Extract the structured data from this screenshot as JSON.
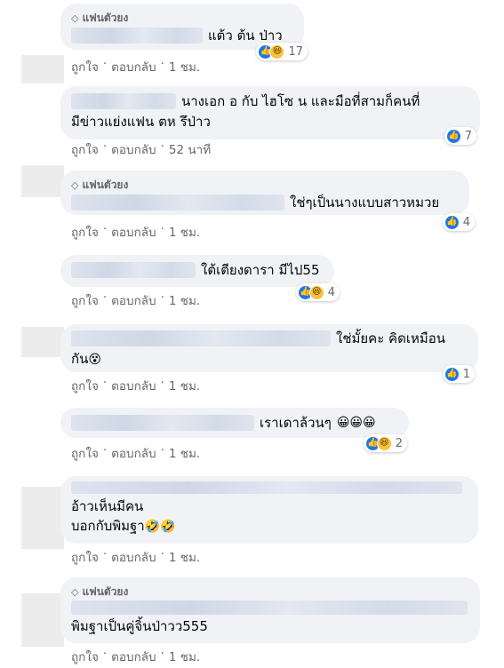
{
  "actions": {
    "like": "ถูกใจ",
    "reply": "ตอบกลับ",
    "dot": "·"
  },
  "badge": "แฟนตัวยง",
  "comments": [
    {
      "text": "แต้ว ต้น ป่าว",
      "time": "1 ชม.",
      "reactions": "17"
    },
    {
      "text1": "นางเอก อ กับ ไฮโซ น และมือที่สามก็คนที่",
      "text2": "มีข่าวแย่งแฟน ตห รึป่าว",
      "time": "52 นาที",
      "reactions": "7"
    },
    {
      "text": "ใช่ๆเป็นนางแบบสาวหมวย",
      "time": "1 ชม.",
      "reactions": "4"
    },
    {
      "text": "ใต้เตียงดารา มีไป55",
      "time": "1 ชม.",
      "reactions": "4"
    },
    {
      "text1": "ใช่มั้ยคะ คิดเหมือน",
      "text2": "กัน",
      "time": "1 ชม.",
      "reactions": "1"
    },
    {
      "text": "เราเดาล้วนๆ",
      "time": "1 ชม.",
      "reactions": "2"
    },
    {
      "text1": "อ้าวเห็นมีคน",
      "text2": "บอกกับพิมฐา",
      "time": "1 ชม."
    },
    {
      "text": "พิมฐาเป็นคู่จิ้นป่าวว555",
      "time": "1 ชม."
    }
  ],
  "icons": {
    "like": "thumbs-up-icon",
    "haha": "laughing-face-icon",
    "badge": "diamond-icon"
  }
}
